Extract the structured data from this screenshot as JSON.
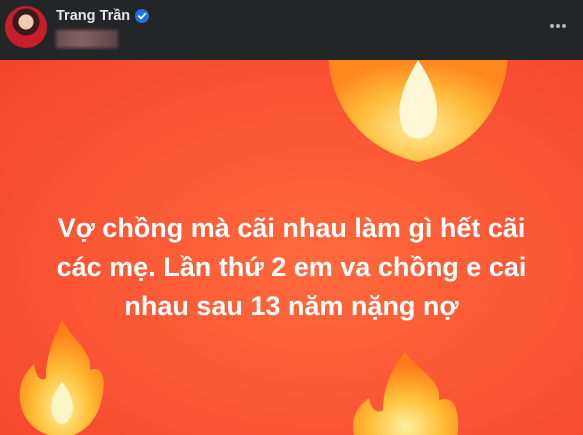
{
  "post": {
    "author_name": "Trang Trần",
    "verified": true,
    "text": "Vợ chồng mà cãi nhau làm gì hết cãi\ncác mẹ. Lần thứ 2 em va chồng e cai\nnhau sau 13 năm nặng nợ",
    "background": {
      "base": "#fb5534",
      "flame_outer": "#ff7a1a",
      "flame_inner": "#ffd84a",
      "flame_core": "#fff6c8"
    }
  },
  "icons": {
    "verified": "verified-badge-icon",
    "more": "more-options-icon"
  }
}
